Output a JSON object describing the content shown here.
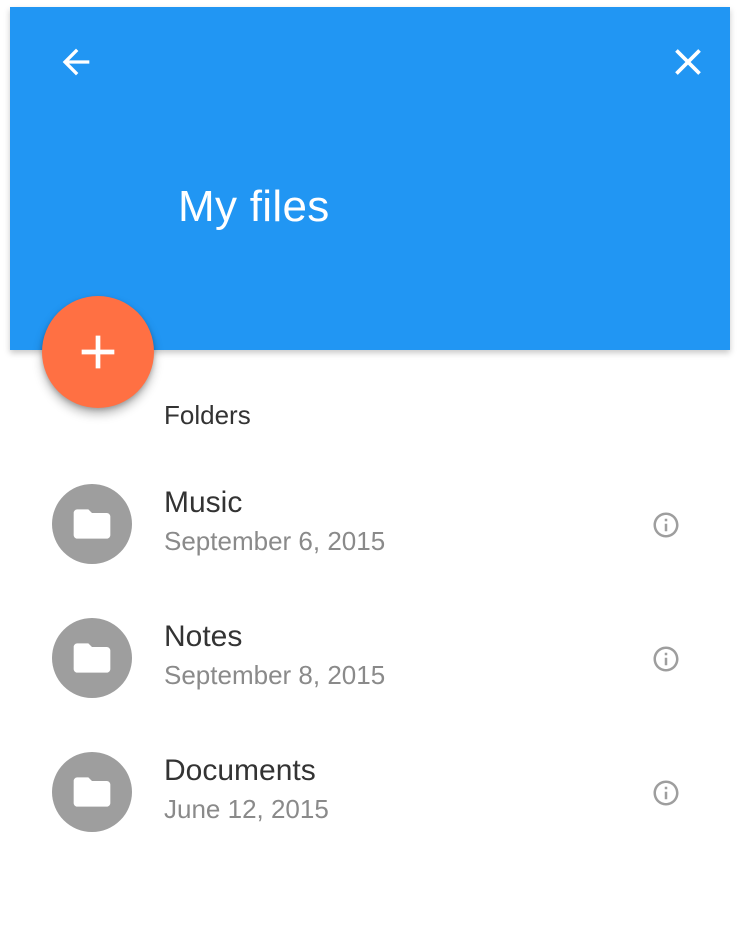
{
  "header": {
    "title": "My files",
    "back_icon": "arrow-back-icon",
    "close_icon": "close-icon",
    "background_color": "#2196f3"
  },
  "fab": {
    "icon": "plus-icon",
    "color": "#ff7043"
  },
  "list": {
    "subheader": "Folders",
    "items": [
      {
        "icon": "folder-icon",
        "title": "Music",
        "date": "September 6, 2015",
        "action_icon": "info-icon"
      },
      {
        "icon": "folder-icon",
        "title": "Notes",
        "date": "September 8, 2015",
        "action_icon": "info-icon"
      },
      {
        "icon": "folder-icon",
        "title": "Documents",
        "date": "June 12, 2015",
        "action_icon": "info-icon"
      }
    ]
  }
}
